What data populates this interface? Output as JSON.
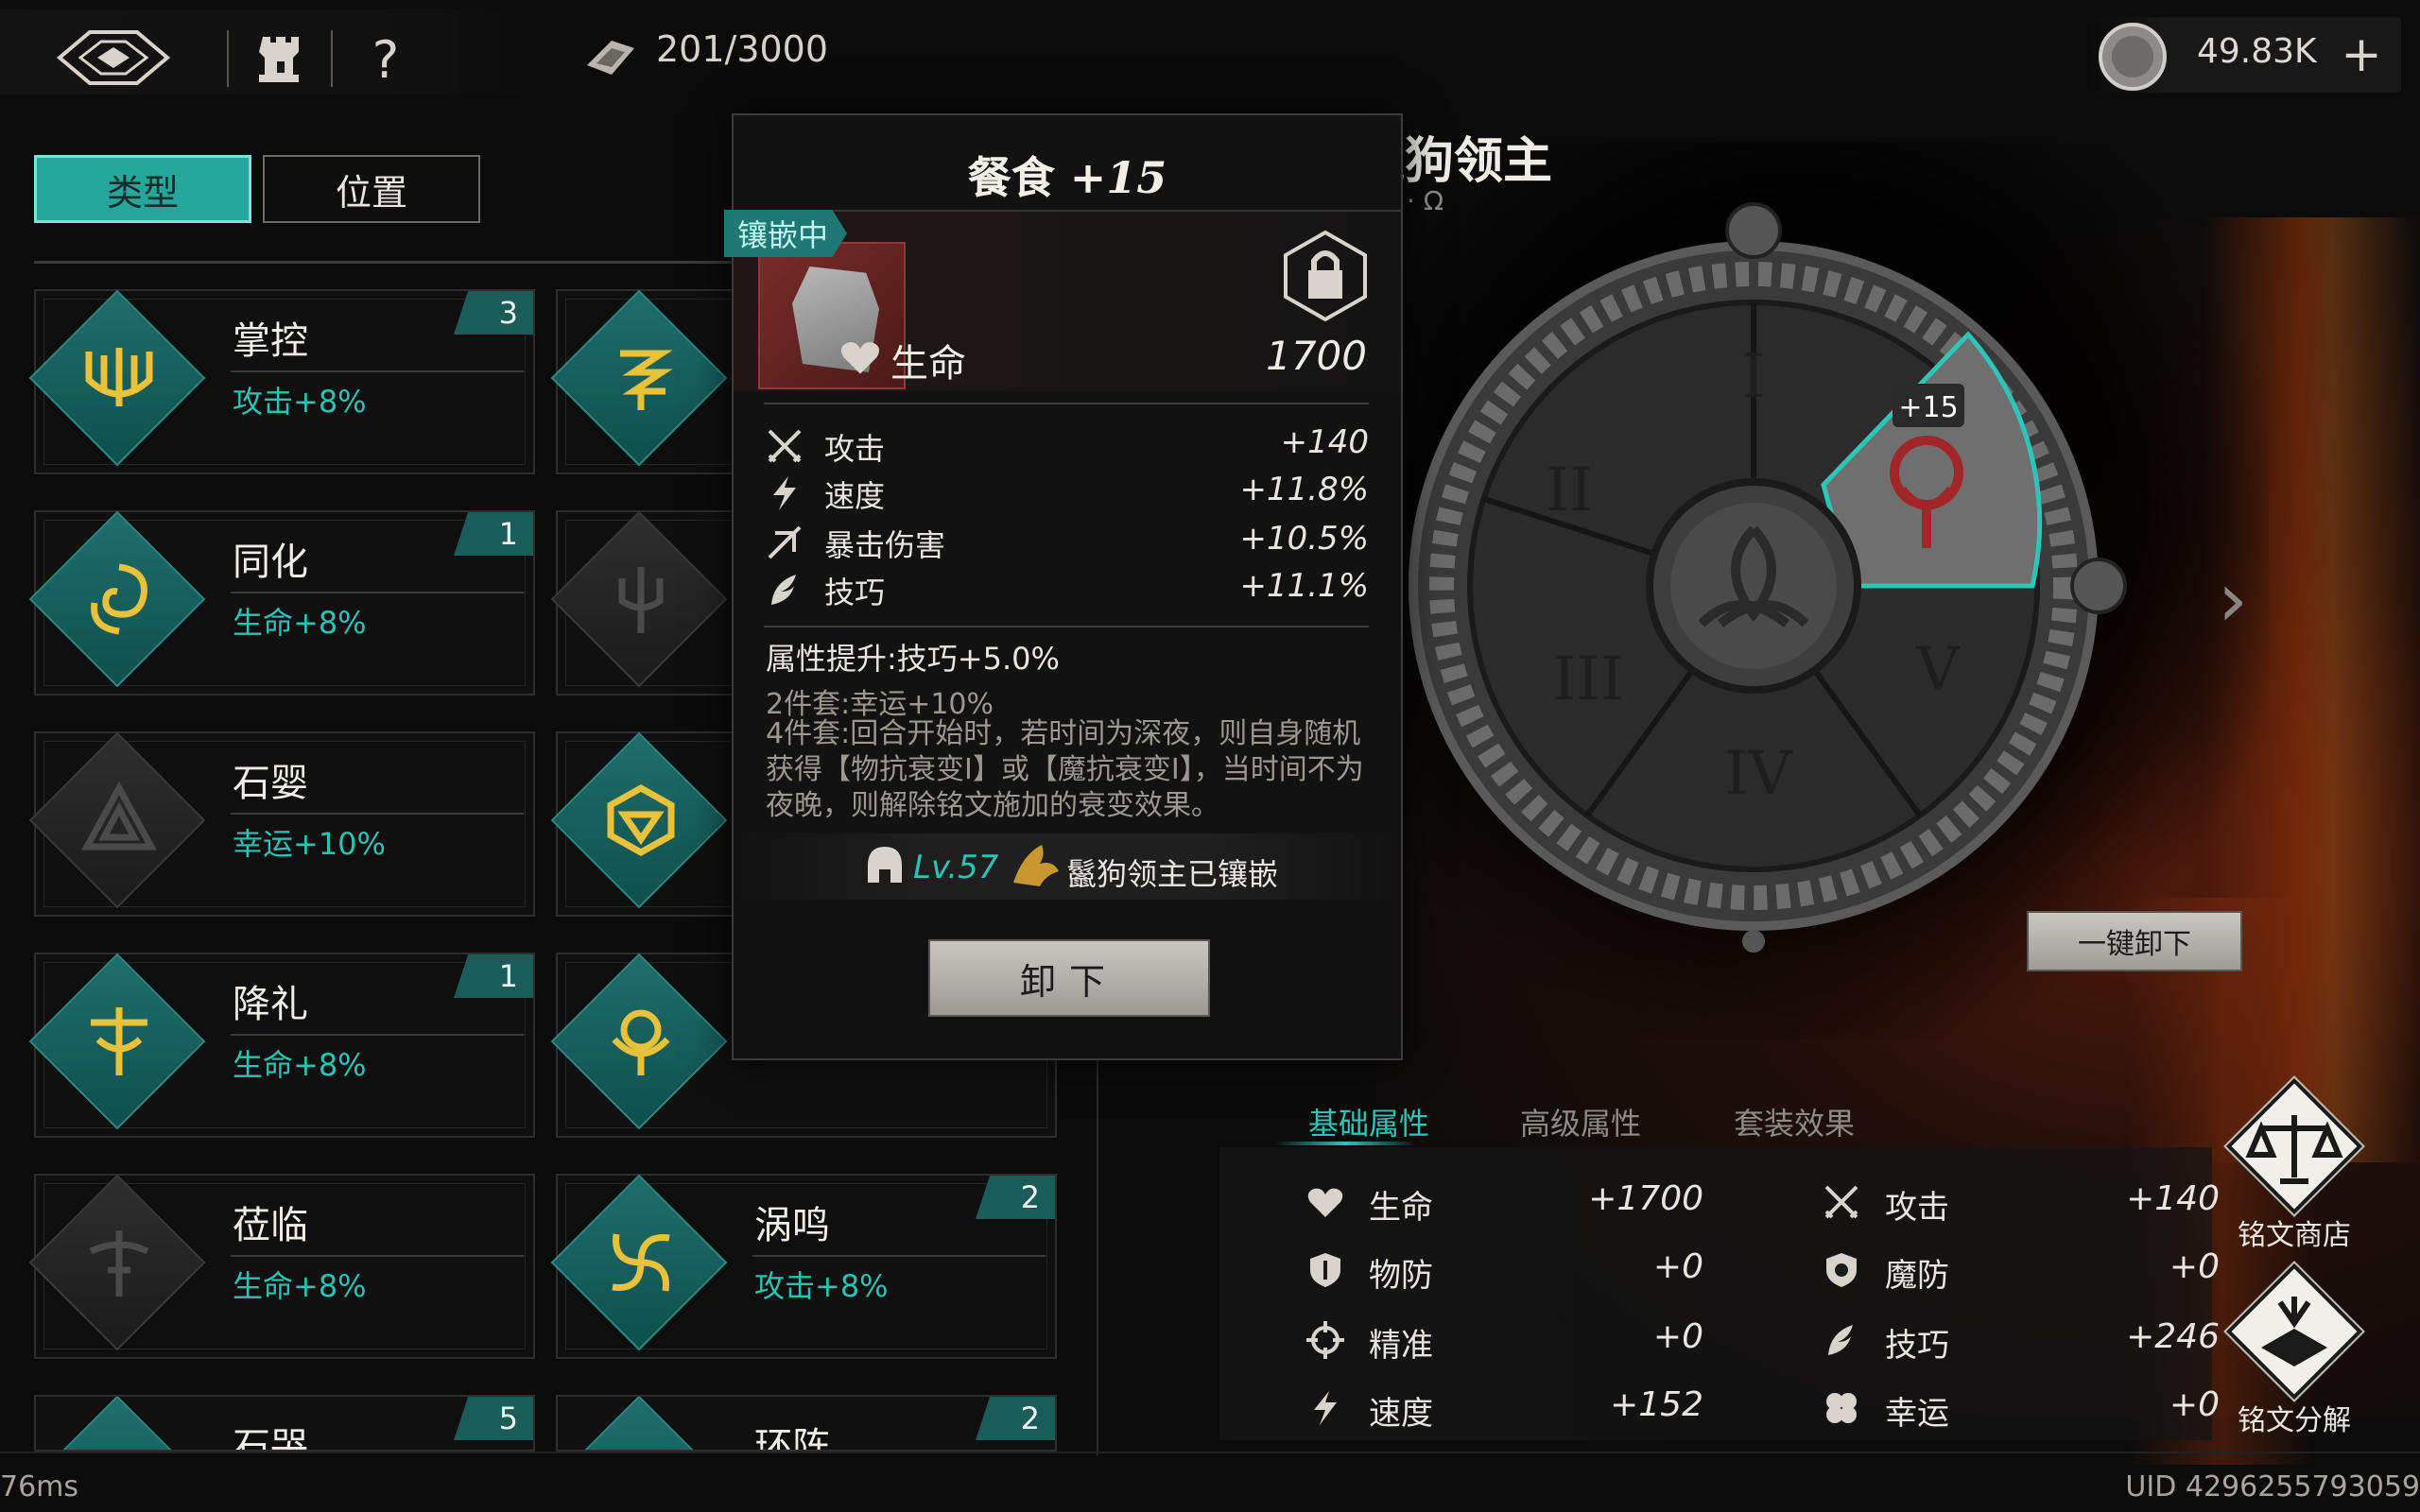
{
  "topbar": {
    "stamina": "201/3000",
    "currency": "49.83K",
    "add_label": "+",
    "help_label": "?"
  },
  "tabs": {
    "type_label": "类型",
    "position_label": "位置"
  },
  "runes": [
    {
      "name": "掌控",
      "bonus": "攻击+8%",
      "count": "3",
      "active": true
    },
    {
      "name": "同化",
      "bonus": "生命+8%",
      "count": "1",
      "active": true
    },
    {
      "name": "石婴",
      "bonus": "幸运+10%",
      "count": "",
      "active": false
    },
    {
      "name": "降礼",
      "bonus": "生命+8%",
      "count": "1",
      "active": true
    },
    {
      "name": "莅临",
      "bonus": "生命+8%",
      "count": "",
      "active": false
    },
    {
      "name": "石哭",
      "bonus": "",
      "count": "5",
      "active": true
    }
  ],
  "runes_col2": [
    {
      "name": "",
      "bonus": "",
      "count": "",
      "active": true
    },
    {
      "name": "",
      "bonus": "",
      "count": "",
      "active": false
    },
    {
      "name": "",
      "bonus": "",
      "count": "",
      "active": true
    },
    {
      "name": "",
      "bonus": "",
      "count": "",
      "active": true
    },
    {
      "name": "涡鸣",
      "bonus": "攻击+8%",
      "count": "2",
      "active": true
    },
    {
      "name": "环阵",
      "bonus": "",
      "count": "2",
      "active": true
    }
  ],
  "popup": {
    "title": "餐食",
    "level": "+15",
    "tag": "镶嵌中",
    "main_stat": {
      "label": "生命",
      "value": "1700"
    },
    "sub_stats": [
      {
        "icon": "crossed-swords-icon",
        "label": "攻击",
        "value": "+140"
      },
      {
        "icon": "speed-icon",
        "label": "速度",
        "value": "+11.8%"
      },
      {
        "icon": "crit-damage-icon",
        "label": "暴击伤害",
        "value": "+10.5%"
      },
      {
        "icon": "skill-icon",
        "label": "技巧",
        "value": "+11.1%"
      }
    ],
    "attr_up": "属性提升:技巧+5.0%",
    "set2": "2件套:幸运+10%",
    "set4": "4件套:回合开始时，若时间为深夜，则自身随机获得【物抗衰变Ⅰ】或【魔抗衰变Ⅰ】，当时间不为夜晚，则解除铭文施加的衰变效果。",
    "owner_level": "Lv.57",
    "owner_text": "鬣狗领主已镶嵌",
    "unequip_label": "卸下"
  },
  "boss": {
    "name": "鬣狗领主",
    "sub": "· Ω"
  },
  "wheel": {
    "slots": [
      "I",
      "II",
      "III",
      "IV",
      "V"
    ],
    "selected_level": "+15"
  },
  "one_key_unequip": "一键卸下",
  "stat_tabs": [
    "基础属性",
    "高级属性",
    "套装效果"
  ],
  "stats_left": [
    {
      "icon": "heart-icon",
      "label": "生命",
      "value": "+1700"
    },
    {
      "icon": "shield-icon",
      "label": "物防",
      "value": "+0"
    },
    {
      "icon": "crosshair-icon",
      "label": "精准",
      "value": "+0"
    },
    {
      "icon": "speed-icon",
      "label": "速度",
      "value": "+152"
    }
  ],
  "stats_right": [
    {
      "icon": "crossed-swords-icon",
      "label": "攻击",
      "value": "+140"
    },
    {
      "icon": "magic-shield-icon",
      "label": "魔防",
      "value": "+0"
    },
    {
      "icon": "skill-icon",
      "label": "技巧",
      "value": "+246"
    },
    {
      "icon": "clover-icon",
      "label": "幸运",
      "value": "+0"
    }
  ],
  "side_buttons": {
    "shop": "铭文商店",
    "decompose": "铭文分解"
  },
  "footer": {
    "latency": "76ms",
    "uid": "UID 4296255793059"
  },
  "colors": {
    "accent": "#27a69c",
    "bonus_text": "#28c3b7",
    "selected_slot": "#2cc6b9"
  }
}
